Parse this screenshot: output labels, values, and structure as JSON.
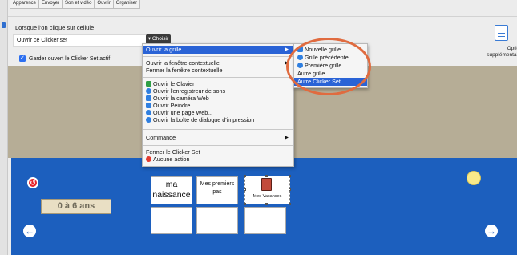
{
  "tabs": [
    "Apparence",
    "Envoyer",
    "Son et vidéo",
    "Ouvrir",
    "Organiser"
  ],
  "options": {
    "click_label": "Lorsque l'on clique sur cellule",
    "action_value": "Ouvrir ce Clicker set",
    "choose_label": "▾ Choisir",
    "keep_open_label": "Garder ouvert le Clicker Set actif",
    "more_options_label": "Options supplémentaires"
  },
  "main_menu": {
    "open_grid": "Ouvrir la grille",
    "open_popup": "Ouvrir la fenêtre contextuelle",
    "close_popup": "Fermer la fenêtre contextuelle",
    "open_keyboard": "Ouvrir le Clavier",
    "open_recorder": "Ouvrir l'enregistreur de sons",
    "open_webcam": "Ouvrir la caméra Web",
    "open_paint": "Ouvrir Peindre",
    "open_webpage": "Ouvrir une page Web...",
    "open_print": "Ouvrir la boîte de dialogue d'impression",
    "command": "Commande",
    "close_clicker": "Fermer le Clicker Set",
    "no_action": "Aucune action"
  },
  "sub_menu": {
    "new_grid": "Nouvelle grille",
    "previous_grid": "Grille précédente",
    "first_grid": "Première grille",
    "other_grid": "Autre grille",
    "other_clicker": "Autre Clicker Set..."
  },
  "grid": {
    "age_label": "0 à 6 ans",
    "cell_birth": "ma naissance",
    "cell_first_steps": "Mes premiers pas",
    "cell_holidays": "Mes Vacances"
  }
}
